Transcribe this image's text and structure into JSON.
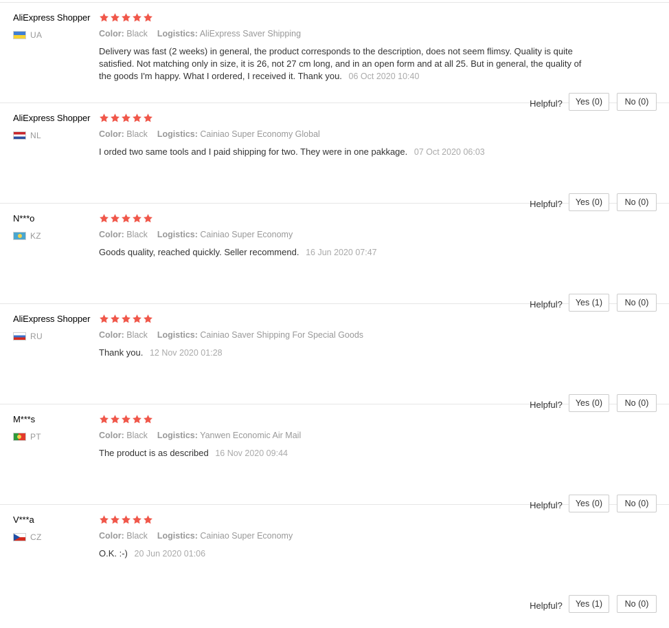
{
  "labels": {
    "color_key": "Color:",
    "logistics_key": "Logistics:",
    "helpful": "Helpful?"
  },
  "colors": {
    "star": "#f0574a",
    "border": "#cccccc",
    "muted_text": "#999999"
  },
  "reviews": [
    {
      "name": "AliExpress Shopper",
      "country": "UA",
      "rating": 5,
      "color": "Black",
      "logistics": "AliExpress Saver Shipping",
      "text": "Delivery was fast (2 weeks) in general, the product corresponds to the description, does not seem flimsy. Quality is quite satisfied. Not matching only in size, it is 26, not 27 cm long, and in an open form and at all 25. But in general, the quality of the goods I'm happy. What I ordered, I received it. Thank you.",
      "date": "06 Oct 2020 10:40",
      "yes": "Yes (0)",
      "no": "No (0)"
    },
    {
      "name": "AliExpress Shopper",
      "country": "NL",
      "rating": 5,
      "color": "Black",
      "logistics": "Cainiao Super Economy Global",
      "text": "I orded two same tools and I paid shipping for two. They were in one pakkage.",
      "date": "07 Oct 2020 06:03",
      "yes": "Yes (0)",
      "no": "No (0)"
    },
    {
      "name": "N***o",
      "country": "KZ",
      "rating": 5,
      "color": "Black",
      "logistics": "Cainiao Super Economy",
      "text": "Goods quality, reached quickly. Seller recommend.",
      "date": "16 Jun 2020 07:47",
      "yes": "Yes (1)",
      "no": "No (0)"
    },
    {
      "name": "AliExpress Shopper",
      "country": "RU",
      "rating": 5,
      "color": "Black",
      "logistics": "Cainiao Saver Shipping For Special Goods",
      "text": "Thank you.",
      "date": "12 Nov 2020 01:28",
      "yes": "Yes (0)",
      "no": "No (0)"
    },
    {
      "name": "M***s",
      "country": "PT",
      "rating": 5,
      "color": "Black",
      "logistics": "Yanwen Economic Air Mail",
      "text": "The product is as described",
      "date": "16 Nov 2020 09:44",
      "yes": "Yes (0)",
      "no": "No (0)"
    },
    {
      "name": "V***a",
      "country": "CZ",
      "rating": 5,
      "color": "Black",
      "logistics": "Cainiao Super Economy",
      "text": "O.K. :-)",
      "date": "20 Jun 2020 01:06",
      "yes": "Yes (1)",
      "no": "No (0)"
    }
  ]
}
